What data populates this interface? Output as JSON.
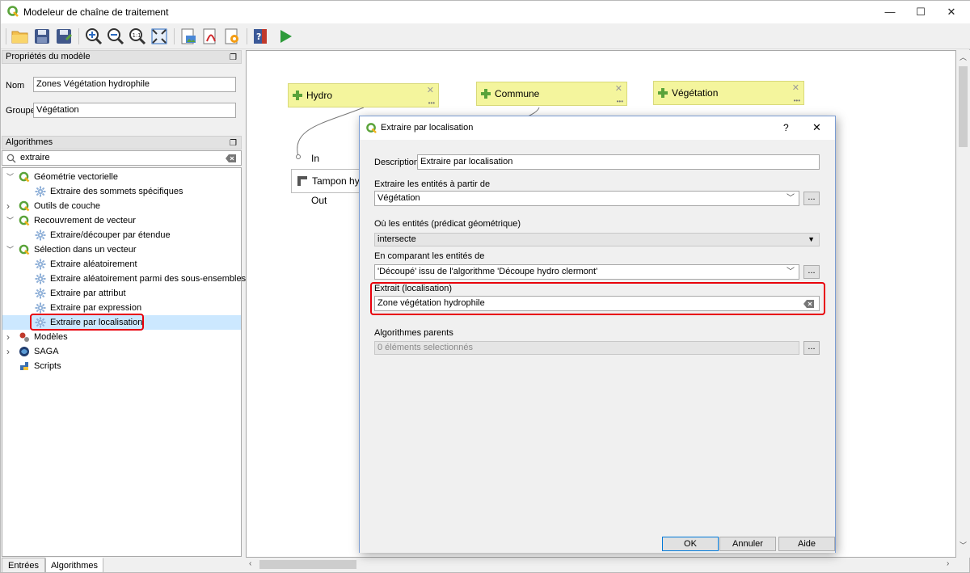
{
  "window": {
    "title": "Modeleur de chaîne de traitement",
    "minimize": "—",
    "maximize": "☐",
    "close": "✕"
  },
  "toolbar": {
    "icons": [
      "open-folder-icon",
      "save-icon",
      "save-as-icon",
      "zoom-in-icon",
      "zoom-out-icon",
      "zoom-actual-icon",
      "zoom-full-icon",
      "export-image-icon",
      "export-pdf-icon",
      "export-svg-icon",
      "help-icon",
      "run-icon"
    ]
  },
  "model_props": {
    "header": "Propriétés du modèle",
    "name_label": "Nom",
    "name_value": "Zones Végétation hydrophile",
    "group_label": "Groupe",
    "group_value": "Végétation"
  },
  "algorithms": {
    "header": "Algorithmes",
    "search_value": "extraire",
    "tree": [
      {
        "label": "Géométrie vectorielle",
        "level": 0,
        "expanded": true,
        "icon": "qgis-icon"
      },
      {
        "label": "Extraire des sommets spécifiques",
        "level": 1,
        "icon": "gear-icon"
      },
      {
        "label": "Outils de couche",
        "level": 0,
        "expanded": false,
        "icon": "qgis-icon"
      },
      {
        "label": "Recouvrement de vecteur",
        "level": 0,
        "expanded": true,
        "icon": "qgis-icon"
      },
      {
        "label": "Extraire/découper par étendue",
        "level": 1,
        "icon": "gear-icon"
      },
      {
        "label": "Sélection dans un vecteur",
        "level": 0,
        "expanded": true,
        "icon": "qgis-icon"
      },
      {
        "label": "Extraire aléatoirement",
        "level": 1,
        "icon": "gear-icon"
      },
      {
        "label": "Extraire aléatoirement parmi des sous-ensembles",
        "level": 1,
        "icon": "gear-icon"
      },
      {
        "label": "Extraire par attribut",
        "level": 1,
        "icon": "gear-icon"
      },
      {
        "label": "Extraire par expression",
        "level": 1,
        "icon": "gear-icon"
      },
      {
        "label": "Extraire par localisation",
        "level": 1,
        "icon": "gear-icon",
        "selected": true
      },
      {
        "label": "Modèles",
        "level": 0,
        "expanded": false,
        "icon": "models-icon"
      },
      {
        "label": "SAGA",
        "level": 0,
        "expanded": false,
        "icon": "saga-icon"
      },
      {
        "label": "Scripts",
        "level": 0,
        "expanded": null,
        "icon": "python-icon"
      }
    ]
  },
  "bottom_tabs": [
    {
      "label": "Entrées"
    },
    {
      "label": "Algorithmes",
      "active": true
    }
  ],
  "canvas": {
    "inputs": [
      {
        "label": "Hydro"
      },
      {
        "label": "Commune"
      },
      {
        "label": "Végétation"
      }
    ],
    "close_glyph": "✕",
    "more_glyph": "•••",
    "algorithm_node": {
      "label": "Tampon hy",
      "in_label": "In",
      "out_label": "Out"
    }
  },
  "dialog": {
    "title": "Extraire par localisation",
    "help": "?",
    "close": "✕",
    "description_label": "Description",
    "description_value": "Extraire par localisation",
    "source_label": "Extraire les entités à partir de",
    "source_value": "Végétation",
    "predicate_label": "Où les entités (prédicat géométrique)",
    "predicate_value": "intersecte",
    "compare_label": "En comparant les entités de",
    "compare_value": "'Découpé' issu de l'algorithme 'Découpe hydro clermont'",
    "output_label": "Extrait (localisation)",
    "output_value": "Zone végétation hydrophile",
    "parents_label": "Algorithmes parents",
    "parents_value": "0 éléments selectionnés",
    "dots": "...",
    "ok": "OK",
    "cancel": "Annuler",
    "help_button": "Aide"
  }
}
